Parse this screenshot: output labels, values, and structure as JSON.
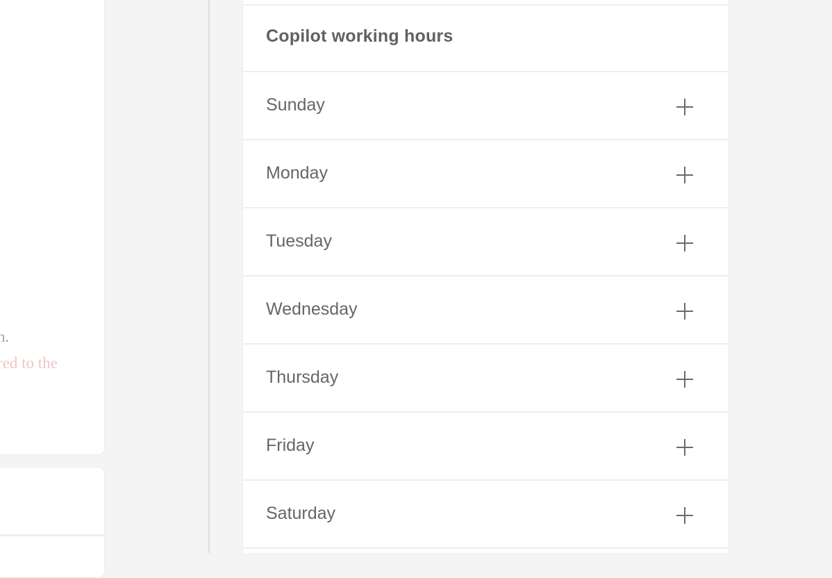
{
  "left_panel": {
    "text_fragment_1": "n.",
    "text_fragment_2": "red to the"
  },
  "working_hours": {
    "title": "Copilot working hours",
    "days": [
      {
        "label": "Sunday",
        "action_icon": "plus-icon"
      },
      {
        "label": "Monday",
        "action_icon": "plus-icon"
      },
      {
        "label": "Tuesday",
        "action_icon": "plus-icon"
      },
      {
        "label": "Wednesday",
        "action_icon": "plus-icon"
      },
      {
        "label": "Thursday",
        "action_icon": "plus-icon"
      },
      {
        "label": "Friday",
        "action_icon": "plus-icon"
      },
      {
        "label": "Saturday",
        "action_icon": "plus-icon"
      }
    ]
  },
  "colors": {
    "background": "#f4f4f4",
    "panel": "#ffffff",
    "text": "#666666",
    "divider": "#dcdcec",
    "warning_text": "#f1c4c4"
  }
}
